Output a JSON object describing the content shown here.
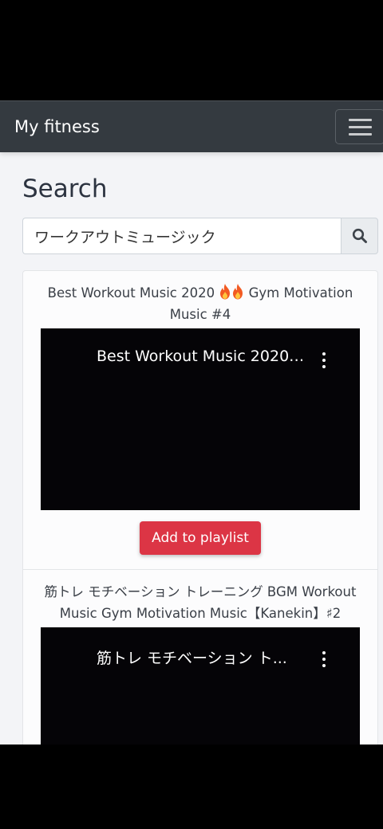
{
  "navbar": {
    "brand": "My fitness",
    "menu_icon": "hamburger-menu-icon"
  },
  "page": {
    "title": "Search"
  },
  "search": {
    "value": "ワークアウトミュージック",
    "button_icon": "search-icon"
  },
  "results": [
    {
      "title_before": "Best Workout Music 2020 ",
      "title_after": " Gym Motivation Music #4",
      "emoji": "fire-emoji",
      "video_title": "Best Workout Music 2020 ...",
      "add_label": "Add to playlist"
    },
    {
      "title": "筋トレ モチベーション トレーニング BGM Workout Music Gym Motivation Music【Kanekin】♯2",
      "video_title": "筋トレ モチベーション ト..."
    }
  ],
  "colors": {
    "navbar": "#343a40",
    "background": "#f3f4f7",
    "add_button": "#dc3545",
    "video": "#050407"
  }
}
